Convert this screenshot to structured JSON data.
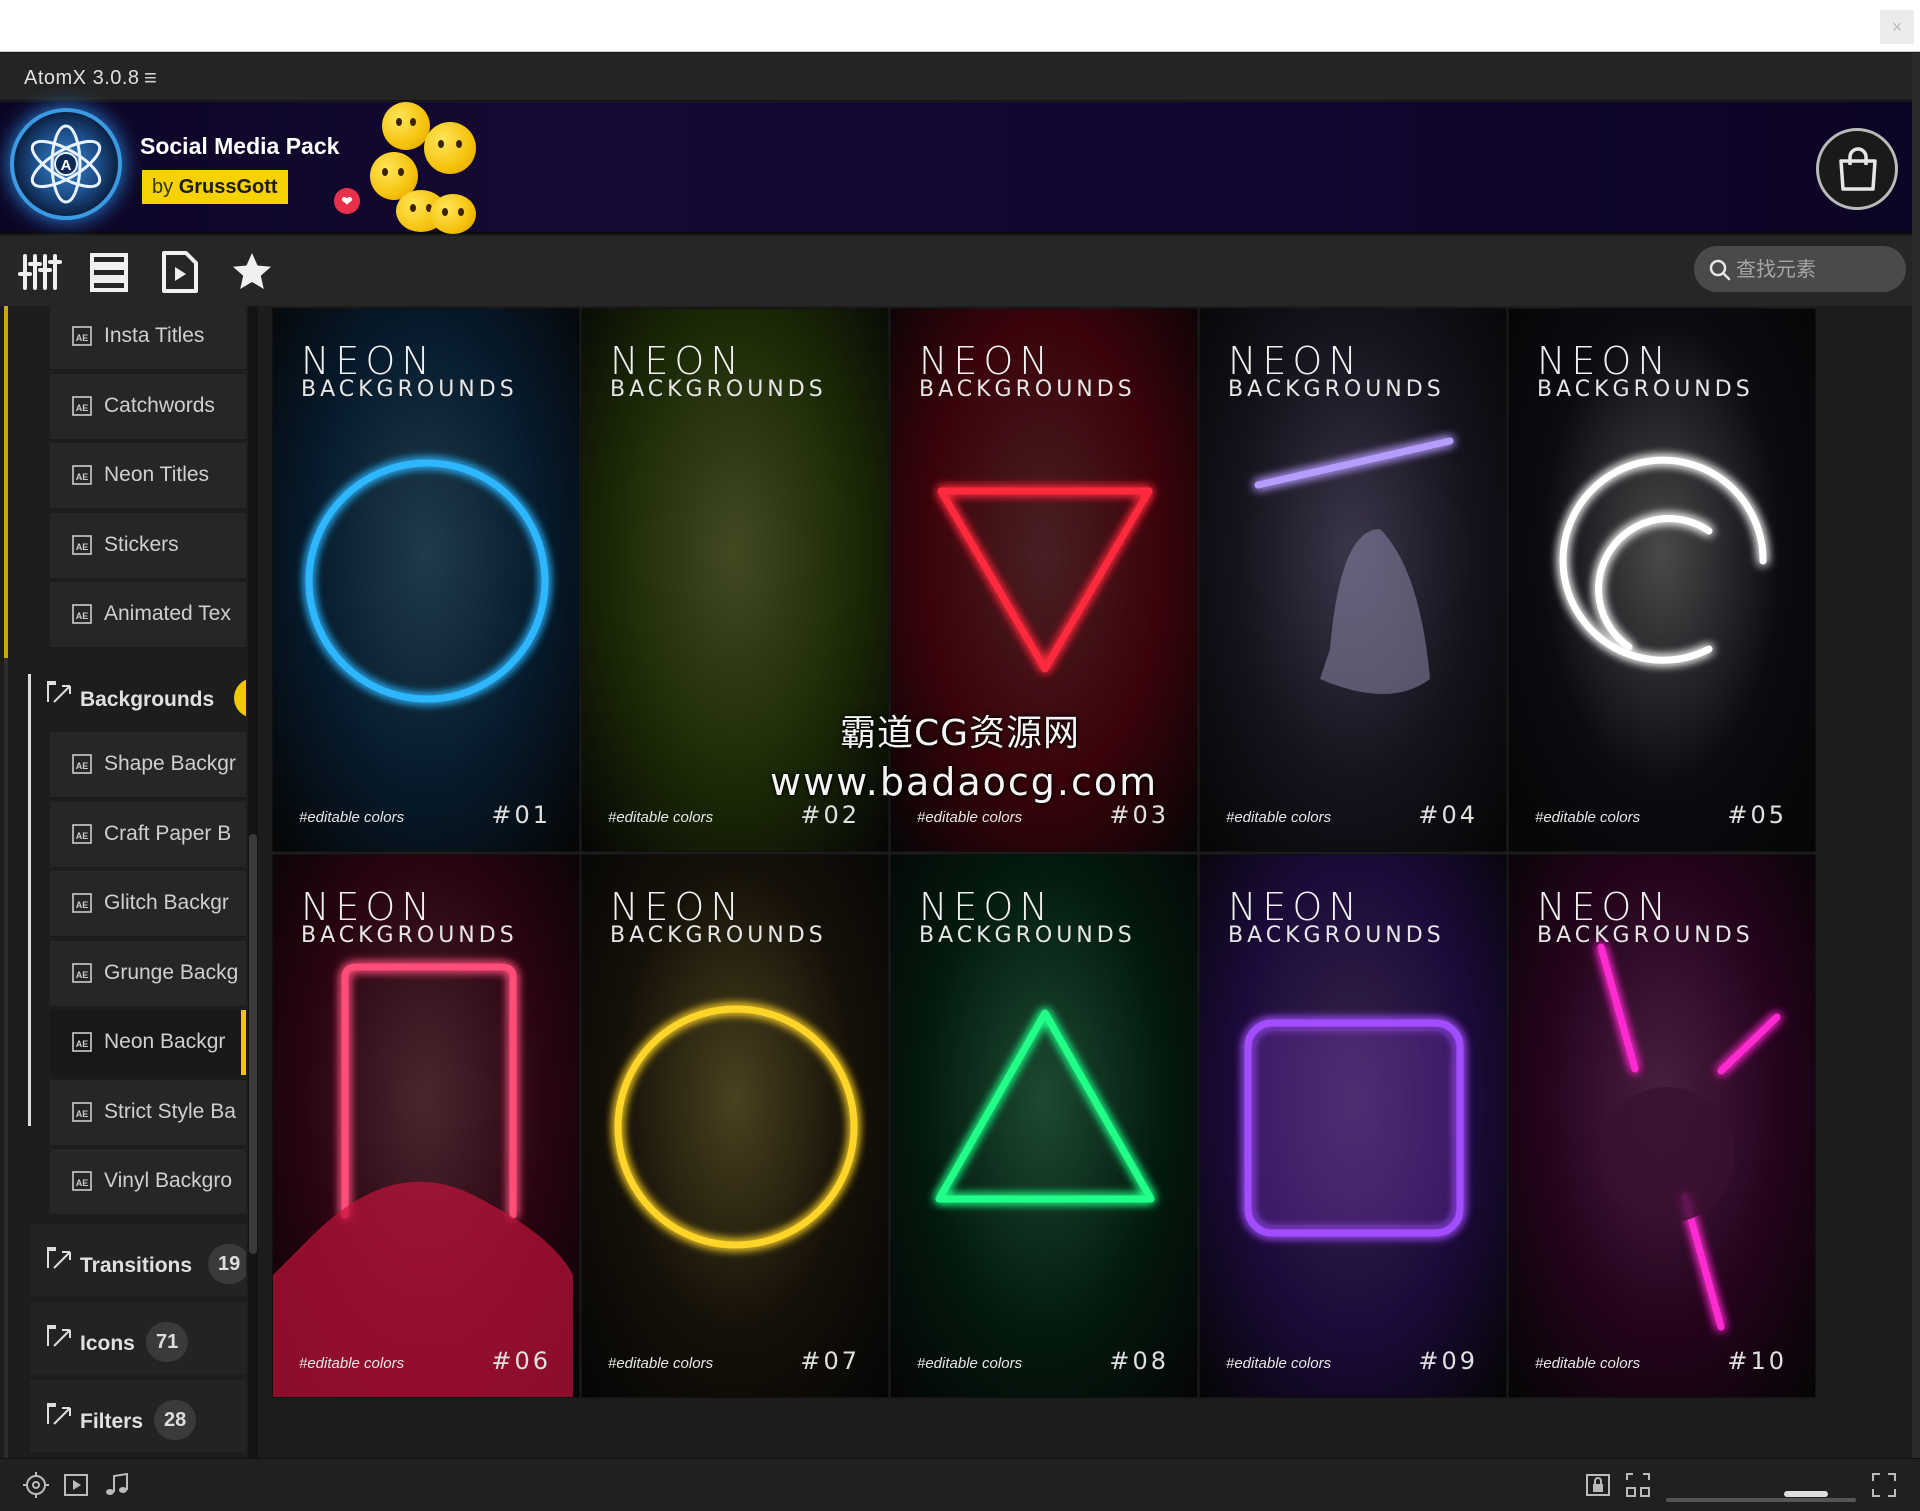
{
  "app": {
    "title": "AtomX 3.0.8",
    "menu_icon": "hamburger-icon",
    "close_glyph": "×"
  },
  "banner": {
    "pack_title": "Social Media Pack",
    "author_prefix": "by",
    "author_name": "GrussGott",
    "heart_glyph": "❤"
  },
  "toolbar": {
    "icons": [
      "sliders-icon",
      "list-view-icon",
      "play-file-icon",
      "star-icon"
    ]
  },
  "search": {
    "placeholder": "查找元素"
  },
  "sidebar": {
    "sub_items_top": [
      {
        "label": "Insta Titles"
      },
      {
        "label": "Catchwords"
      },
      {
        "label": "Neon Titles"
      },
      {
        "label": "Stickers"
      },
      {
        "label": "Animated Tex"
      }
    ],
    "backgrounds": {
      "label": "Backgrounds",
      "count": ""
    },
    "sub_items_backgrounds": [
      {
        "label": "Shape Backgr"
      },
      {
        "label": "Craft Paper B"
      },
      {
        "label": "Glitch Backgr"
      },
      {
        "label": "Grunge Backg"
      },
      {
        "label": "Neon Backgr",
        "active": true
      },
      {
        "label": "Strict Style Ba"
      },
      {
        "label": "Vinyl Backgro"
      }
    ],
    "categories": [
      {
        "label": "Transitions",
        "count": "19"
      },
      {
        "label": "Icons",
        "count": "71"
      },
      {
        "label": "Filters",
        "count": "28"
      }
    ]
  },
  "tiles": [
    {
      "title1": "NEON",
      "title2": "BACKGROUNDS",
      "tag": "#editable colors",
      "number": "#01",
      "shape": "circle",
      "color": "#2fb6ff"
    },
    {
      "title1": "NEON",
      "title2": "BACKGROUNDS",
      "tag": "#editable colors",
      "number": "#02",
      "shape": "bars",
      "color": "#d9ff3a"
    },
    {
      "title1": "NEON",
      "title2": "BACKGROUNDS",
      "tag": "#editable colors",
      "number": "#03",
      "shape": "triangle-down",
      "color": "#ff2a3c"
    },
    {
      "title1": "NEON",
      "title2": "BACKGROUNDS",
      "tag": "#editable colors",
      "number": "#04",
      "shape": "tube",
      "color": "#b79cff"
    },
    {
      "title1": "NEON",
      "title2": "BACKGROUNDS",
      "tag": "#editable colors",
      "number": "#05",
      "shape": "double-circle",
      "color": "#ffffff"
    },
    {
      "title1": "NEON",
      "title2": "BACKGROUNDS",
      "tag": "#editable colors",
      "number": "#06",
      "shape": "rectangle",
      "color": "#ff4d7a"
    },
    {
      "title1": "NEON",
      "title2": "BACKGROUNDS",
      "tag": "#editable colors",
      "number": "#07",
      "shape": "circle",
      "color": "#ffd52a"
    },
    {
      "title1": "NEON",
      "title2": "BACKGROUNDS",
      "tag": "#editable colors",
      "number": "#08",
      "shape": "triangle-up",
      "color": "#22ff88"
    },
    {
      "title1": "NEON",
      "title2": "BACKGROUNDS",
      "tag": "#editable colors",
      "number": "#09",
      "shape": "square",
      "color": "#a24dff"
    },
    {
      "title1": "NEON",
      "title2": "BACKGROUNDS",
      "tag": "#editable colors",
      "number": "#10",
      "shape": "lines",
      "color": "#ff2ad0"
    }
  ],
  "watermark": {
    "line1": "霸道CG资源网",
    "line2": "www.badaocg.com"
  },
  "statusbar": {
    "left_icons": [
      "target-icon",
      "video-icon",
      "music-icon"
    ],
    "right_icons": [
      "lock-icon",
      "fit-icon",
      "expand-icon"
    ]
  },
  "colors": {
    "accent": "#f0c800",
    "bg": "#1c1c1c",
    "panel": "#262626"
  }
}
